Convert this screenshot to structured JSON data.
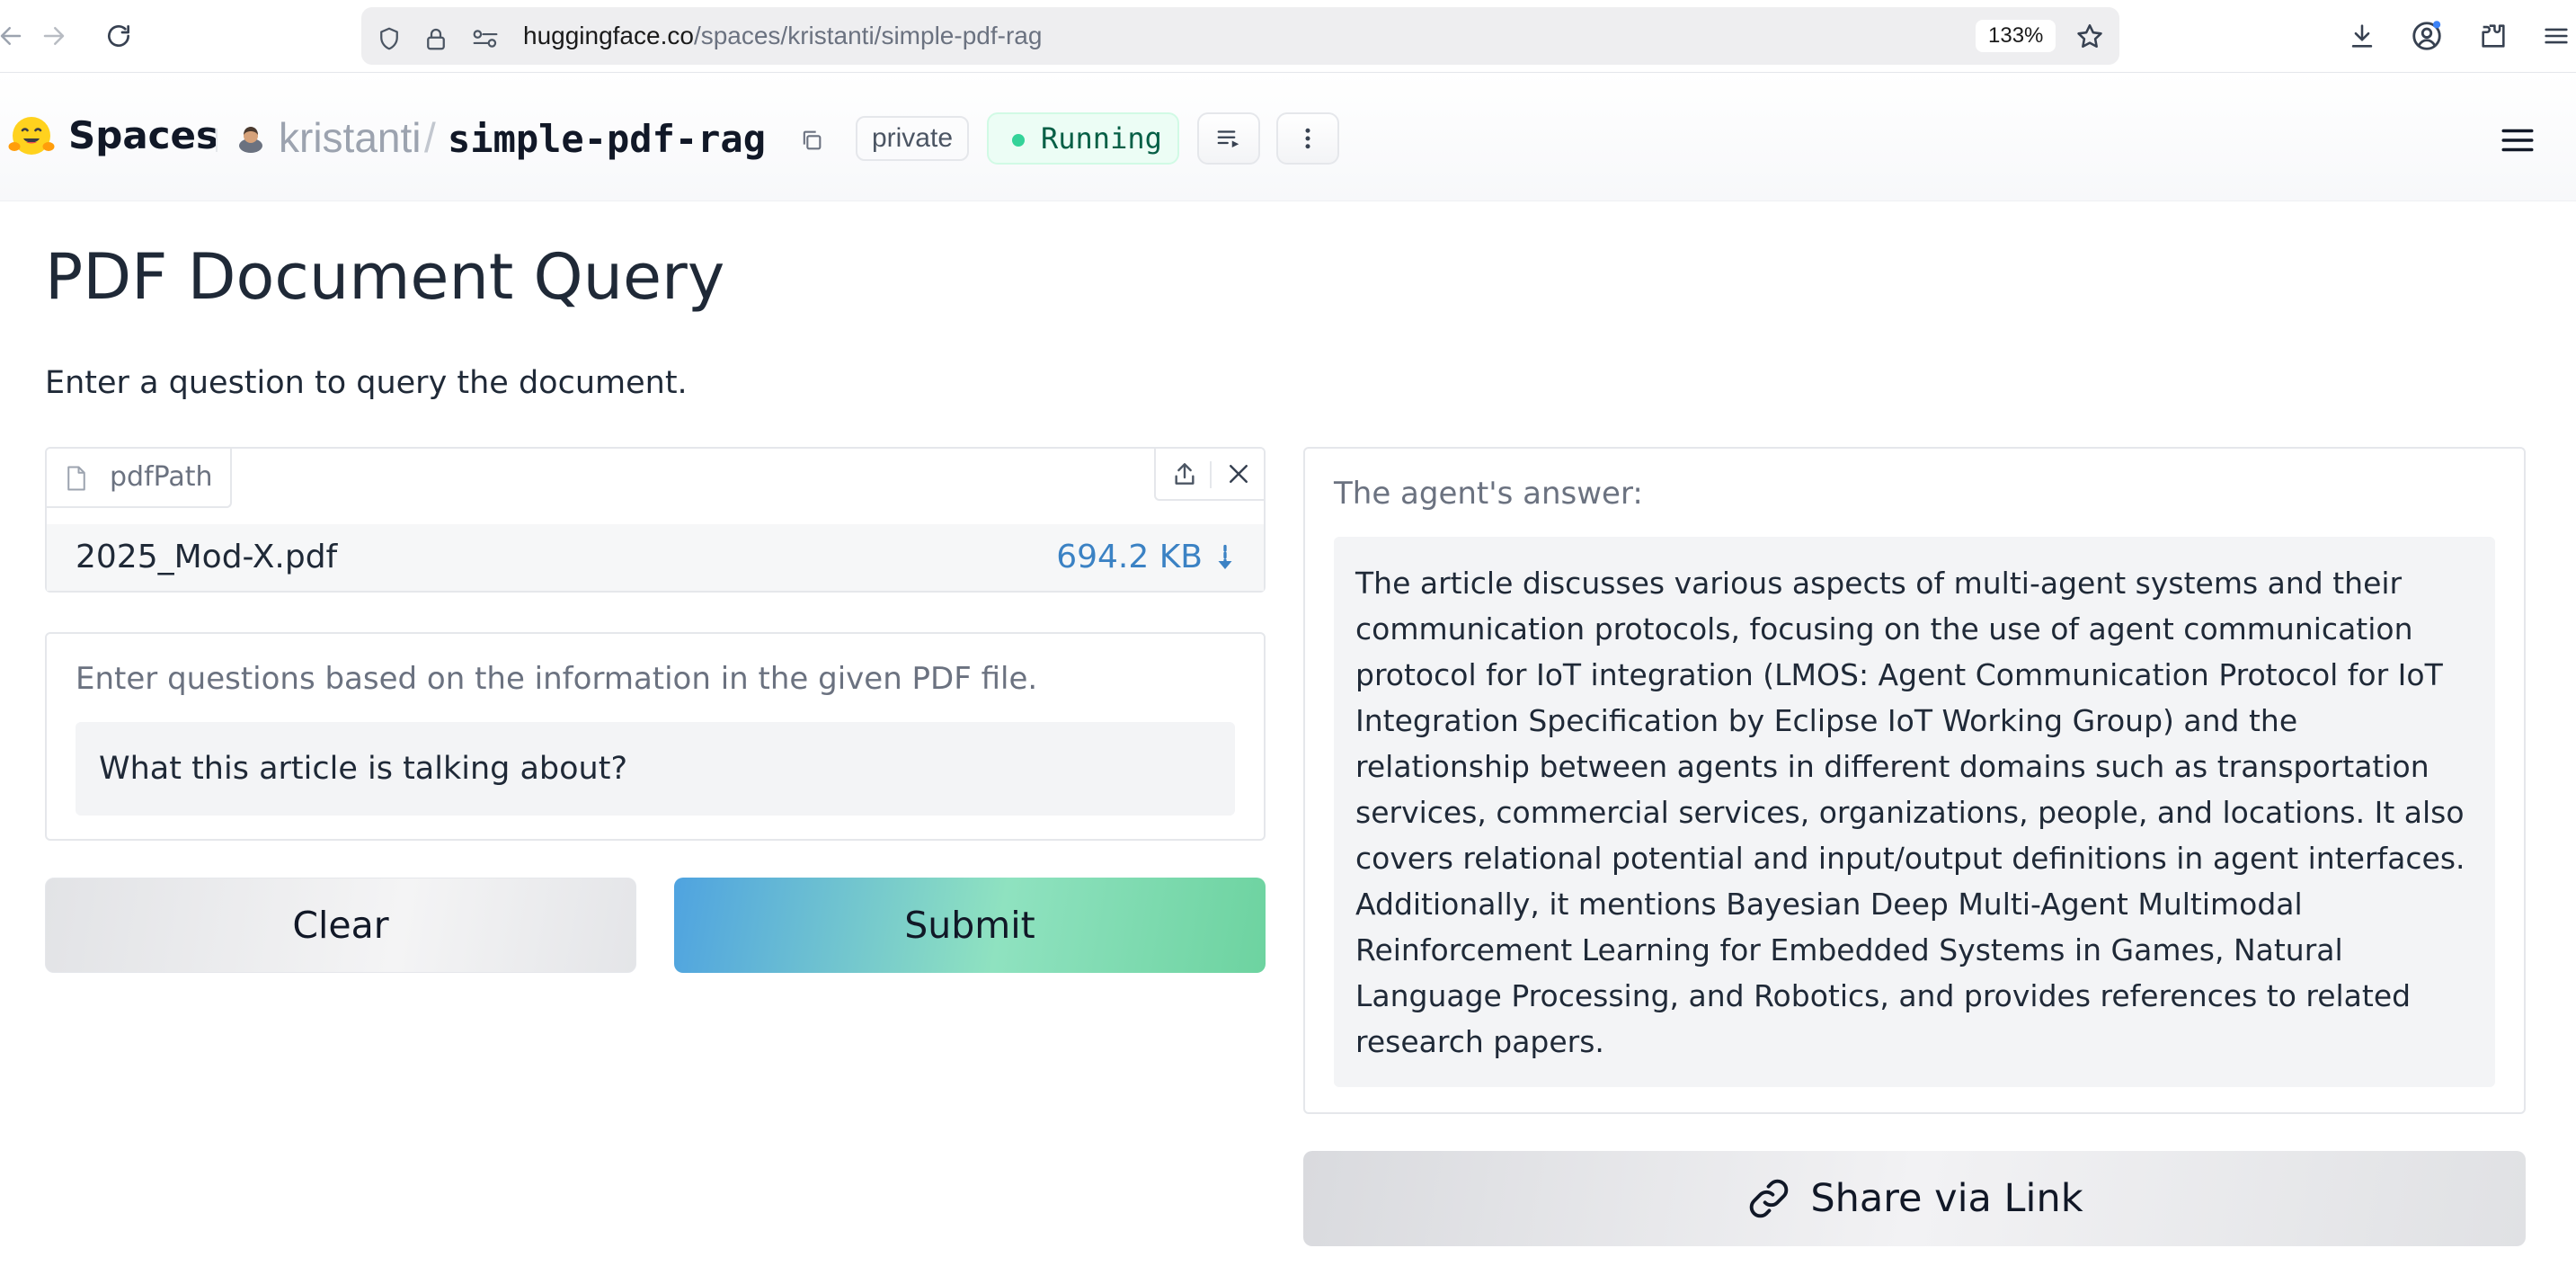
{
  "browser": {
    "url_domain": "huggingface.co",
    "url_path": "/spaces/kristanti/simple-pdf-rag",
    "zoom": "133%"
  },
  "header": {
    "spaces_label": "Spaces",
    "owner": "kristanti",
    "separator": "/",
    "repo": "simple-pdf-rag",
    "visibility_badge": "private",
    "status": "Running"
  },
  "app": {
    "title": "PDF Document Query",
    "description": "Enter a question to query the document.",
    "file_input": {
      "label": "pdfPath",
      "file_name": "2025_Mod-X.pdf",
      "file_size": "694.2 KB"
    },
    "question": {
      "label": "Enter questions based on the information in the given PDF file.",
      "value": "What this article is talking about?"
    },
    "buttons": {
      "clear": "Clear",
      "submit": "Submit",
      "share": "Share via Link"
    },
    "answer": {
      "label": "The agent's answer:",
      "text": "The article discusses various aspects of multi-agent systems and their communication protocols, focusing on the use of agent communication protocol for IoT integration (LMOS: Agent Communication Protocol for IoT Integration Specification by Eclipse IoT Working Group) and the relationship between agents in different domains such as transportation services, commercial services, organizations, people, and locations. It also covers relational potential and input/output definitions in agent interfaces. Additionally, it mentions Bayesian Deep Multi-Agent Multimodal Reinforcement Learning for Embedded Systems in Games, Natural Language Processing, and Robotics, and provides references to related research papers."
    }
  },
  "colors": {
    "accent_blue": "#3b82c4",
    "running_green": "#34d399",
    "submit_gradient_start": "#4fa3e0",
    "submit_gradient_end": "#6dd3a0"
  },
  "icons": {
    "browser": [
      "back-arrow-icon",
      "forward-arrow-icon",
      "reload-icon",
      "shield-icon",
      "lock-icon",
      "site-settings-icon",
      "star-icon",
      "download-icon",
      "account-icon",
      "extensions-icon",
      "menu-icon"
    ],
    "header": [
      "hugging-face-logo-icon",
      "owner-avatar-icon",
      "copy-icon",
      "playlist-icon",
      "more-vertical-icon",
      "hamburger-menu-icon"
    ],
    "app": [
      "file-icon",
      "upload-icon",
      "close-icon",
      "download-icon",
      "link-icon"
    ]
  }
}
